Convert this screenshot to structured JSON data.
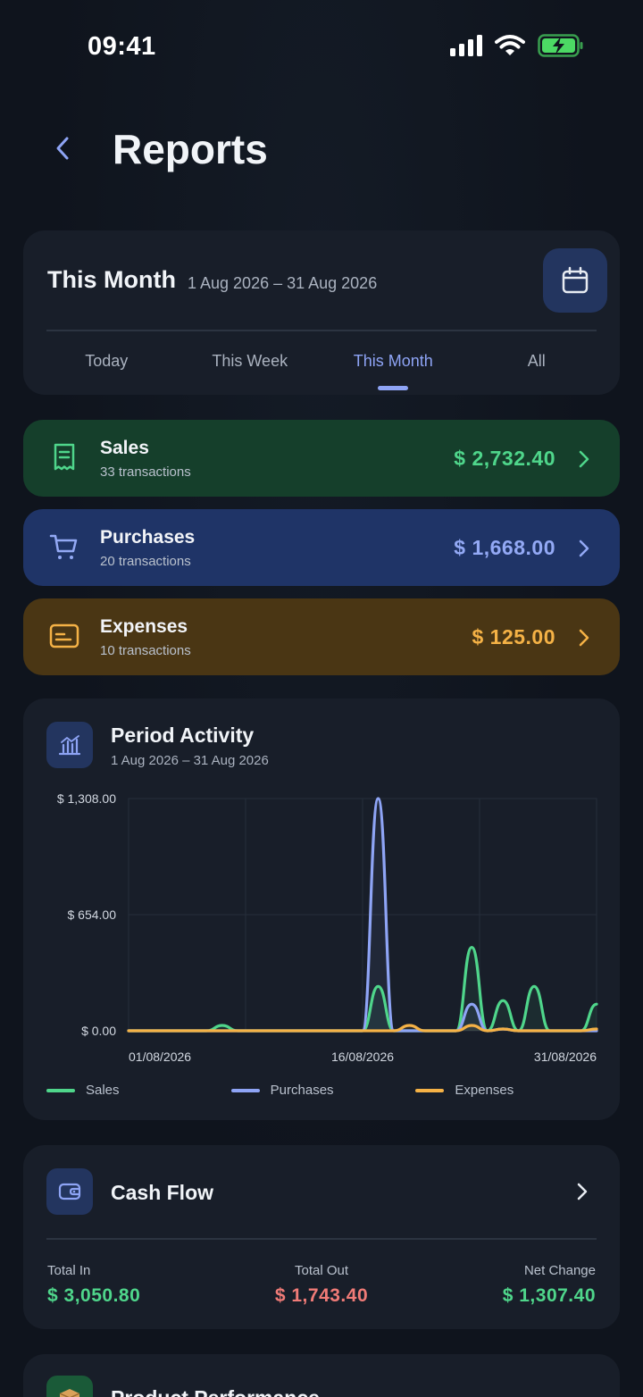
{
  "status_bar": {
    "time": "09:41"
  },
  "header": {
    "title": "Reports"
  },
  "period": {
    "title": "This Month",
    "range": "1 Aug 2026 – 31 Aug 2026",
    "tabs": [
      {
        "label": "Today",
        "active": false
      },
      {
        "label": "This Week",
        "active": false
      },
      {
        "label": "This Month",
        "active": true
      },
      {
        "label": "All",
        "active": false
      }
    ]
  },
  "summary": {
    "sales": {
      "title": "Sales",
      "subtitle": "33 transactions",
      "amount": "$ 2,732.40"
    },
    "purchases": {
      "title": "Purchases",
      "subtitle": "20 transactions",
      "amount": "$ 1,668.00"
    },
    "expenses": {
      "title": "Expenses",
      "subtitle": "10 transactions",
      "amount": "$ 125.00"
    }
  },
  "activity": {
    "title": "Period Activity",
    "range": "1 Aug 2026 – 31 Aug 2026"
  },
  "chart_data": {
    "type": "line",
    "x": [
      "01/08/2026",
      "02/08/2026",
      "03/08/2026",
      "04/08/2026",
      "05/08/2026",
      "06/08/2026",
      "07/08/2026",
      "08/08/2026",
      "09/08/2026",
      "10/08/2026",
      "11/08/2026",
      "12/08/2026",
      "13/08/2026",
      "14/08/2026",
      "15/08/2026",
      "16/08/2026",
      "17/08/2026",
      "18/08/2026",
      "19/08/2026",
      "20/08/2026",
      "21/08/2026",
      "22/08/2026",
      "23/08/2026",
      "24/08/2026",
      "25/08/2026",
      "26/08/2026",
      "27/08/2026",
      "28/08/2026",
      "29/08/2026",
      "30/08/2026",
      "31/08/2026"
    ],
    "x_ticks": [
      "01/08/2026",
      "16/08/2026",
      "31/08/2026"
    ],
    "y_ticks": [
      "$ 0.00",
      "$ 654.00",
      "$ 1,308.00"
    ],
    "ylim": [
      0,
      1308
    ],
    "series": [
      {
        "name": "Sales",
        "color": "#4fd68b",
        "values": [
          0,
          0,
          0,
          0,
          0,
          0,
          30,
          0,
          0,
          0,
          0,
          0,
          0,
          0,
          0,
          0,
          250,
          0,
          0,
          0,
          0,
          0,
          470,
          0,
          170,
          0,
          250,
          0,
          0,
          0,
          150
        ]
      },
      {
        "name": "Purchases",
        "color": "#8ea4f5",
        "values": [
          0,
          0,
          0,
          0,
          0,
          0,
          0,
          0,
          0,
          0,
          0,
          0,
          0,
          0,
          0,
          0,
          1308,
          0,
          0,
          0,
          0,
          0,
          150,
          0,
          10,
          0,
          0,
          0,
          0,
          0,
          0
        ]
      },
      {
        "name": "Expenses",
        "color": "#f5b246",
        "values": [
          0,
          0,
          0,
          0,
          0,
          0,
          0,
          0,
          0,
          0,
          0,
          0,
          0,
          0,
          0,
          0,
          0,
          0,
          30,
          0,
          0,
          0,
          30,
          0,
          10,
          0,
          0,
          0,
          0,
          0,
          10
        ]
      }
    ],
    "grid": true,
    "legend": "bottom"
  },
  "cash_flow": {
    "title": "Cash Flow",
    "total_in_label": "Total In",
    "total_in": "$ 3,050.80",
    "total_out_label": "Total Out",
    "total_out": "$ 1,743.40",
    "net_label": "Net Change",
    "net": "$ 1,307.40"
  },
  "product": {
    "title": "Product Performance"
  },
  "colors": {
    "accent": "#8ea4f5",
    "sales": "#4fd68b",
    "purchases": "#93a9f5",
    "expenses": "#f5b246",
    "negative": "#f07b77"
  }
}
